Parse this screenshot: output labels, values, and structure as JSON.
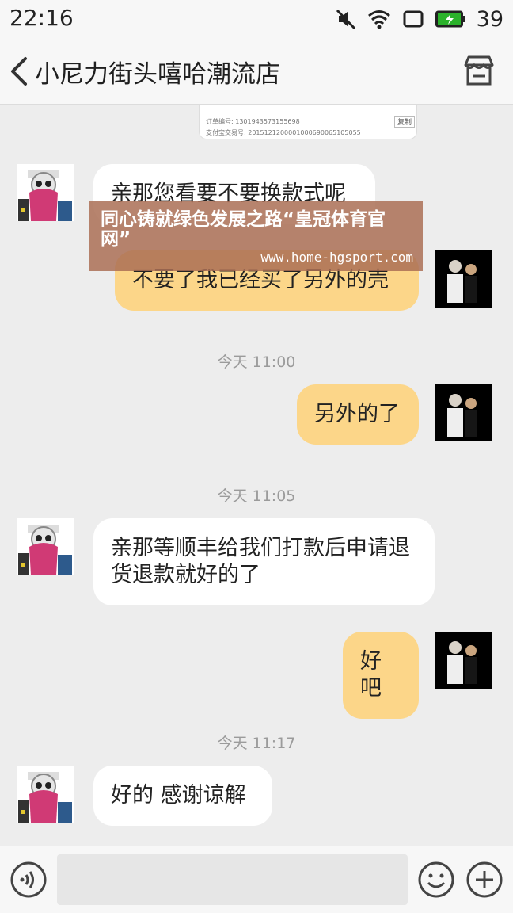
{
  "status_bar": {
    "time": "22:16",
    "battery": "39",
    "battery_color": "#2bb22b"
  },
  "header": {
    "title": "小尼力街头嘻哈潮流店",
    "back_icon": "chevron-left-icon",
    "shop_icon": "store-icon"
  },
  "order_card": {
    "order_no": "订单编号: 1301943573155698",
    "alipay_no": "支付宝交易号: 2015121200001000690065105055",
    "copy_label": "复制"
  },
  "messages": [
    {
      "side": "in",
      "text": "亲那您看要不要换款式呢"
    },
    {
      "side": "out",
      "text": "不要了我已经买了另外的壳"
    },
    {
      "time": "今天 11:00"
    },
    {
      "side": "out",
      "text": "另外的了"
    },
    {
      "time": "今天 11:05"
    },
    {
      "side": "in",
      "text": "亲那等顺丰给我们打款后申请退货退款就好的了"
    },
    {
      "side": "out",
      "text": "好吧"
    },
    {
      "time": "今天 11:17"
    },
    {
      "side": "in",
      "text": "好的  感谢谅解"
    }
  ],
  "watermark": {
    "title": "同心铸就绿色发展之路“皇冠体育官网”",
    "url": "www.home-hgsport.com"
  },
  "input_bar": {
    "placeholder": "",
    "voice_icon": "voice-icon",
    "emoji_icon": "emoji-icon",
    "plus_icon": "plus-icon"
  },
  "colors": {
    "outgoing_bubble": "#fcd689",
    "incoming_bubble": "#ffffff",
    "chat_bg": "#ededed"
  }
}
